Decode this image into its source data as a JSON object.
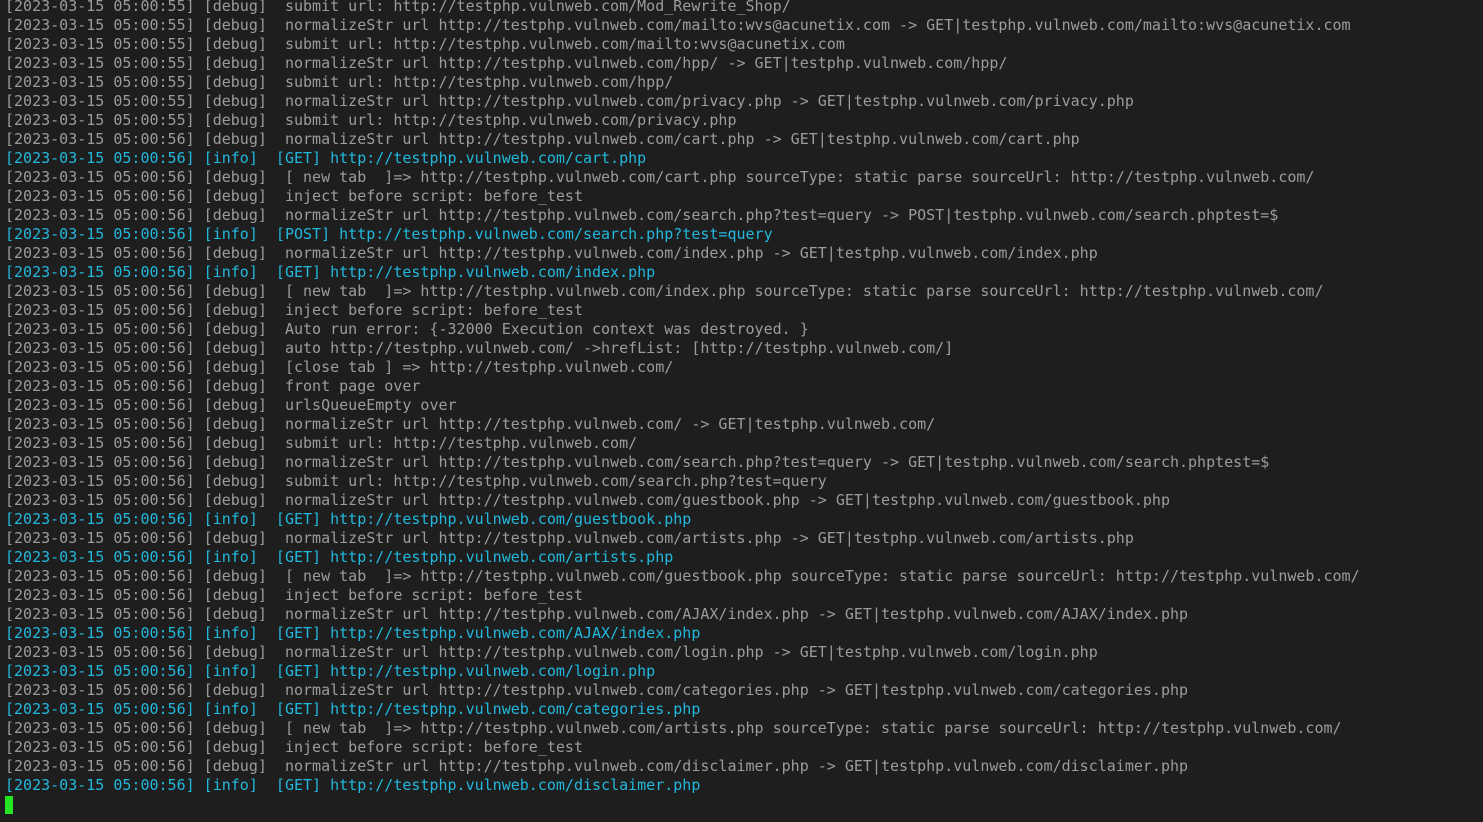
{
  "terminal": {
    "colors": {
      "background": "#1e1e1e",
      "debug": "#9c9c9c",
      "info": "#22b8dd",
      "cursor": "#22e622"
    },
    "lines": [
      {
        "level": "debug",
        "text": "[2023-03-15 05:00:55] [debug]  submit url: http://testphp.vulnweb.com/Mod_Rewrite_Shop/"
      },
      {
        "level": "debug",
        "text": "[2023-03-15 05:00:55] [debug]  normalizeStr url http://testphp.vulnweb.com/mailto:wvs@acunetix.com -> GET|testphp.vulnweb.com/mailto:wvs@acunetix.com"
      },
      {
        "level": "debug",
        "text": "[2023-03-15 05:00:55] [debug]  submit url: http://testphp.vulnweb.com/mailto:wvs@acunetix.com"
      },
      {
        "level": "debug",
        "text": "[2023-03-15 05:00:55] [debug]  normalizeStr url http://testphp.vulnweb.com/hpp/ -> GET|testphp.vulnweb.com/hpp/"
      },
      {
        "level": "debug",
        "text": "[2023-03-15 05:00:55] [debug]  submit url: http://testphp.vulnweb.com/hpp/"
      },
      {
        "level": "debug",
        "text": "[2023-03-15 05:00:55] [debug]  normalizeStr url http://testphp.vulnweb.com/privacy.php -> GET|testphp.vulnweb.com/privacy.php"
      },
      {
        "level": "debug",
        "text": "[2023-03-15 05:00:55] [debug]  submit url: http://testphp.vulnweb.com/privacy.php"
      },
      {
        "level": "debug",
        "text": "[2023-03-15 05:00:56] [debug]  normalizeStr url http://testphp.vulnweb.com/cart.php -> GET|testphp.vulnweb.com/cart.php"
      },
      {
        "level": "info",
        "text": "[2023-03-15 05:00:56] [info]  [GET] http://testphp.vulnweb.com/cart.php"
      },
      {
        "level": "debug",
        "text": "[2023-03-15 05:00:56] [debug]  [ new tab  ]=> http://testphp.vulnweb.com/cart.php sourceType: static parse sourceUrl: http://testphp.vulnweb.com/"
      },
      {
        "level": "debug",
        "text": "[2023-03-15 05:00:56] [debug]  inject before script: before_test"
      },
      {
        "level": "debug",
        "text": "[2023-03-15 05:00:56] [debug]  normalizeStr url http://testphp.vulnweb.com/search.php?test=query -> POST|testphp.vulnweb.com/search.phptest=$"
      },
      {
        "level": "info",
        "text": "[2023-03-15 05:00:56] [info]  [POST] http://testphp.vulnweb.com/search.php?test=query"
      },
      {
        "level": "debug",
        "text": "[2023-03-15 05:00:56] [debug]  normalizeStr url http://testphp.vulnweb.com/index.php -> GET|testphp.vulnweb.com/index.php"
      },
      {
        "level": "info",
        "text": "[2023-03-15 05:00:56] [info]  [GET] http://testphp.vulnweb.com/index.php"
      },
      {
        "level": "debug",
        "text": "[2023-03-15 05:00:56] [debug]  [ new tab  ]=> http://testphp.vulnweb.com/index.php sourceType: static parse sourceUrl: http://testphp.vulnweb.com/"
      },
      {
        "level": "debug",
        "text": "[2023-03-15 05:00:56] [debug]  inject before script: before_test"
      },
      {
        "level": "debug",
        "text": "[2023-03-15 05:00:56] [debug]  Auto run error: {-32000 Execution context was destroyed. }"
      },
      {
        "level": "debug",
        "text": "[2023-03-15 05:00:56] [debug]  auto http://testphp.vulnweb.com/ ->hrefList: [http://testphp.vulnweb.com/]"
      },
      {
        "level": "debug",
        "text": "[2023-03-15 05:00:56] [debug]  [close tab ] => http://testphp.vulnweb.com/"
      },
      {
        "level": "debug",
        "text": "[2023-03-15 05:00:56] [debug]  front page over"
      },
      {
        "level": "debug",
        "text": "[2023-03-15 05:00:56] [debug]  urlsQueueEmpty over"
      },
      {
        "level": "debug",
        "text": "[2023-03-15 05:00:56] [debug]  normalizeStr url http://testphp.vulnweb.com/ -> GET|testphp.vulnweb.com/"
      },
      {
        "level": "debug",
        "text": "[2023-03-15 05:00:56] [debug]  submit url: http://testphp.vulnweb.com/"
      },
      {
        "level": "debug",
        "text": "[2023-03-15 05:00:56] [debug]  normalizeStr url http://testphp.vulnweb.com/search.php?test=query -> GET|testphp.vulnweb.com/search.phptest=$"
      },
      {
        "level": "debug",
        "text": "[2023-03-15 05:00:56] [debug]  submit url: http://testphp.vulnweb.com/search.php?test=query"
      },
      {
        "level": "debug",
        "text": "[2023-03-15 05:00:56] [debug]  normalizeStr url http://testphp.vulnweb.com/guestbook.php -> GET|testphp.vulnweb.com/guestbook.php"
      },
      {
        "level": "info",
        "text": "[2023-03-15 05:00:56] [info]  [GET] http://testphp.vulnweb.com/guestbook.php"
      },
      {
        "level": "debug",
        "text": "[2023-03-15 05:00:56] [debug]  normalizeStr url http://testphp.vulnweb.com/artists.php -> GET|testphp.vulnweb.com/artists.php"
      },
      {
        "level": "info",
        "text": "[2023-03-15 05:00:56] [info]  [GET] http://testphp.vulnweb.com/artists.php"
      },
      {
        "level": "debug",
        "text": "[2023-03-15 05:00:56] [debug]  [ new tab  ]=> http://testphp.vulnweb.com/guestbook.php sourceType: static parse sourceUrl: http://testphp.vulnweb.com/"
      },
      {
        "level": "debug",
        "text": "[2023-03-15 05:00:56] [debug]  inject before script: before_test"
      },
      {
        "level": "debug",
        "text": "[2023-03-15 05:00:56] [debug]  normalizeStr url http://testphp.vulnweb.com/AJAX/index.php -> GET|testphp.vulnweb.com/AJAX/index.php"
      },
      {
        "level": "info",
        "text": "[2023-03-15 05:00:56] [info]  [GET] http://testphp.vulnweb.com/AJAX/index.php"
      },
      {
        "level": "debug",
        "text": "[2023-03-15 05:00:56] [debug]  normalizeStr url http://testphp.vulnweb.com/login.php -> GET|testphp.vulnweb.com/login.php"
      },
      {
        "level": "info",
        "text": "[2023-03-15 05:00:56] [info]  [GET] http://testphp.vulnweb.com/login.php"
      },
      {
        "level": "debug",
        "text": "[2023-03-15 05:00:56] [debug]  normalizeStr url http://testphp.vulnweb.com/categories.php -> GET|testphp.vulnweb.com/categories.php"
      },
      {
        "level": "info",
        "text": "[2023-03-15 05:00:56] [info]  [GET] http://testphp.vulnweb.com/categories.php"
      },
      {
        "level": "debug",
        "text": "[2023-03-15 05:00:56] [debug]  [ new tab  ]=> http://testphp.vulnweb.com/artists.php sourceType: static parse sourceUrl: http://testphp.vulnweb.com/"
      },
      {
        "level": "debug",
        "text": "[2023-03-15 05:00:56] [debug]  inject before script: before_test"
      },
      {
        "level": "debug",
        "text": "[2023-03-15 05:00:56] [debug]  normalizeStr url http://testphp.vulnweb.com/disclaimer.php -> GET|testphp.vulnweb.com/disclaimer.php"
      },
      {
        "level": "info",
        "text": "[2023-03-15 05:00:56] [info]  [GET] http://testphp.vulnweb.com/disclaimer.php"
      }
    ]
  }
}
